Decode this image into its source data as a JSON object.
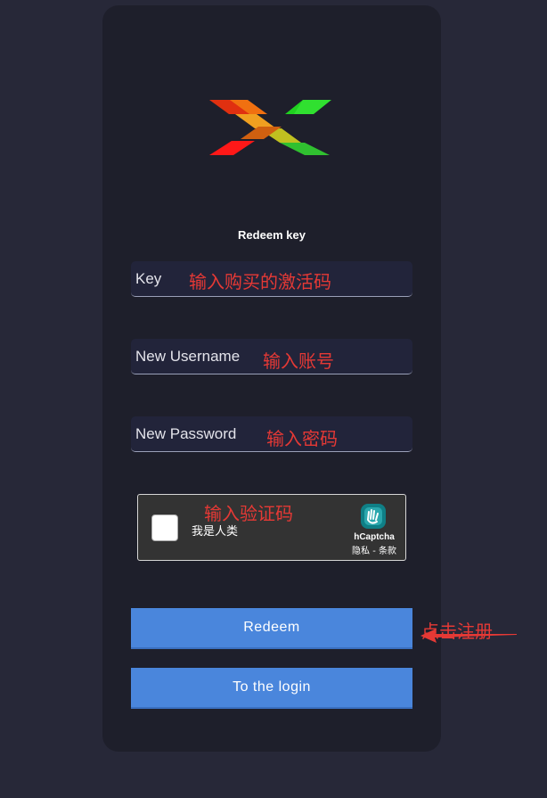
{
  "form": {
    "subtitle": "Redeem key",
    "key_label": "Key",
    "username_label": "New Username",
    "password_label": "New Password",
    "redeem_label": "Redeem",
    "login_label": "To the login"
  },
  "captcha": {
    "checkbox_label": "我是人类",
    "brand": "hCaptcha",
    "links": "隐私 - 条款"
  },
  "annotations": {
    "key_hint": "输入购买的激活码",
    "username_hint": "输入账号",
    "password_hint": "输入密码",
    "captcha_hint": "输入验证码",
    "redeem_hint": "点击注册"
  },
  "colors": {
    "page_bg": "#272838",
    "card_bg": "#1e1f2b",
    "button": "#4a86dc",
    "annotation": "#e53935"
  },
  "icons": {
    "logo": "x-logo-icon",
    "captcha": "hcaptcha-hand-icon",
    "arrow": "red-arrow-icon"
  }
}
